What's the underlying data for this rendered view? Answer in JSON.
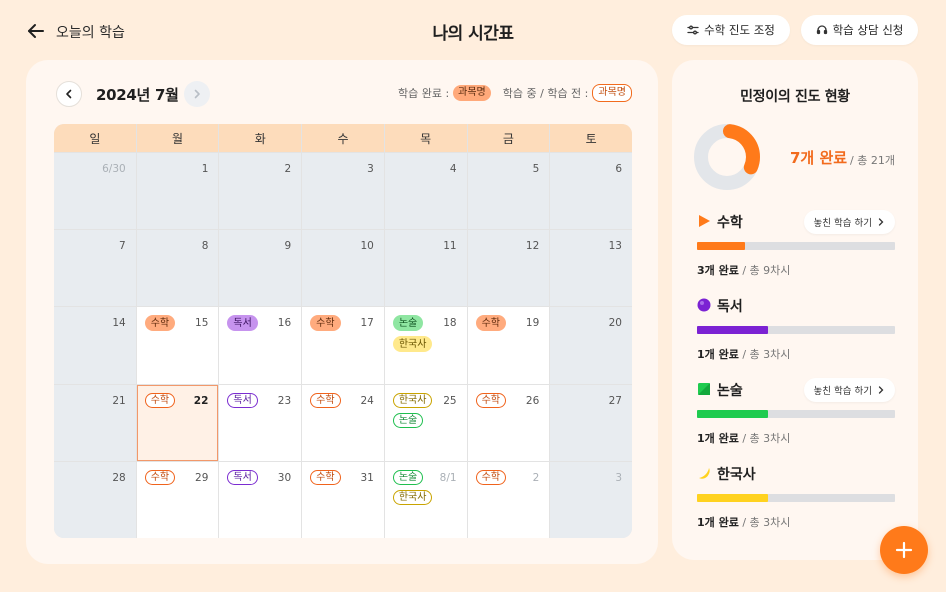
{
  "header": {
    "back_label": "오늘의 학습",
    "title": "나의 시간표",
    "adjust_button": "수학 진도 조정",
    "consult_button": "학습 상담 신청"
  },
  "calendar": {
    "month_label": "2024년 7월",
    "legend": {
      "done_label": "학습 완료 :",
      "pending_label": "학습 중 / 학습 전 :",
      "chip_text": "과목명"
    },
    "weekdays": [
      "일",
      "월",
      "화",
      "수",
      "목",
      "금",
      "토"
    ],
    "weeks": [
      [
        {
          "label": "6/30",
          "muted": true,
          "grey": true,
          "chips": []
        },
        {
          "label": "1",
          "grey": true,
          "chips": []
        },
        {
          "label": "2",
          "grey": true,
          "chips": []
        },
        {
          "label": "3",
          "grey": true,
          "chips": []
        },
        {
          "label": "4",
          "grey": true,
          "chips": []
        },
        {
          "label": "5",
          "grey": true,
          "chips": []
        },
        {
          "label": "6",
          "grey": true,
          "chips": []
        }
      ],
      [
        {
          "label": "7",
          "grey": true,
          "chips": []
        },
        {
          "label": "8",
          "grey": true,
          "chips": []
        },
        {
          "label": "9",
          "grey": true,
          "chips": []
        },
        {
          "label": "10",
          "grey": true,
          "chips": []
        },
        {
          "label": "11",
          "grey": true,
          "chips": []
        },
        {
          "label": "12",
          "grey": true,
          "chips": []
        },
        {
          "label": "13",
          "grey": true,
          "chips": []
        }
      ],
      [
        {
          "label": "14",
          "grey": true,
          "chips": []
        },
        {
          "label": "15",
          "chips": [
            {
              "text": "수학",
              "subject": "math",
              "style": "filled"
            }
          ]
        },
        {
          "label": "16",
          "chips": [
            {
              "text": "독서",
              "subject": "read",
              "style": "filled"
            }
          ]
        },
        {
          "label": "17",
          "chips": [
            {
              "text": "수학",
              "subject": "math",
              "style": "filled"
            }
          ]
        },
        {
          "label": "18",
          "chips": [
            {
              "text": "논술",
              "subject": "essay",
              "style": "filled"
            },
            {
              "text": "한국사",
              "subject": "hist",
              "style": "filled"
            }
          ]
        },
        {
          "label": "19",
          "chips": [
            {
              "text": "수학",
              "subject": "math",
              "style": "filled"
            }
          ]
        },
        {
          "label": "20",
          "grey": true,
          "chips": []
        }
      ],
      [
        {
          "label": "21",
          "grey": true,
          "chips": []
        },
        {
          "label": "22",
          "bold": true,
          "selected": true,
          "chips": [
            {
              "text": "수학",
              "subject": "math",
              "style": "outline"
            }
          ]
        },
        {
          "label": "23",
          "chips": [
            {
              "text": "독서",
              "subject": "read",
              "style": "outline"
            }
          ]
        },
        {
          "label": "24",
          "chips": [
            {
              "text": "수학",
              "subject": "math",
              "style": "outline"
            }
          ]
        },
        {
          "label": "25",
          "chips": [
            {
              "text": "한국사",
              "subject": "hist",
              "style": "outline"
            },
            {
              "text": "논술",
              "subject": "essay",
              "style": "outline"
            }
          ]
        },
        {
          "label": "26",
          "chips": [
            {
              "text": "수학",
              "subject": "math",
              "style": "outline"
            }
          ]
        },
        {
          "label": "27",
          "grey": true,
          "chips": []
        }
      ],
      [
        {
          "label": "28",
          "grey": true,
          "chips": []
        },
        {
          "label": "29",
          "chips": [
            {
              "text": "수학",
              "subject": "math",
              "style": "outline"
            }
          ]
        },
        {
          "label": "30",
          "chips": [
            {
              "text": "독서",
              "subject": "read",
              "style": "outline"
            }
          ]
        },
        {
          "label": "31",
          "chips": [
            {
              "text": "수학",
              "subject": "math",
              "style": "outline"
            }
          ]
        },
        {
          "label": "8/1",
          "muted": true,
          "chips": [
            {
              "text": "논술",
              "subject": "essay",
              "style": "outline"
            },
            {
              "text": "한국사",
              "subject": "hist",
              "style": "outline"
            }
          ]
        },
        {
          "label": "2",
          "muted": true,
          "chips": [
            {
              "text": "수학",
              "subject": "math",
              "style": "outline"
            }
          ]
        },
        {
          "label": "3",
          "muted": true,
          "grey": true,
          "chips": []
        }
      ]
    ]
  },
  "progress": {
    "title": "민정이의 진도 현황",
    "done_count": "7개 완료",
    "total": "/ 총 21개",
    "overall_fraction": 0.333,
    "subjects": [
      {
        "name": "수학",
        "icon": "play-triangle-icon",
        "color": "#FF7A1A",
        "fraction": 0.24,
        "done": "3개 완료",
        "total": "/ 총 9차시",
        "missed_button": "놓친 학습 하기"
      },
      {
        "name": "독서",
        "icon": "purple-circle-icon",
        "color": "#7B22D3",
        "fraction": 0.36,
        "done": "1개 완료",
        "total": "/ 총 3차시",
        "missed_button": null
      },
      {
        "name": "논술",
        "icon": "green-square-icon",
        "color": "#1FCB4F",
        "fraction": 0.36,
        "done": "1개 완료",
        "total": "/ 총 3차시",
        "missed_button": "놓친 학습 하기"
      },
      {
        "name": "한국사",
        "icon": "yellow-moon-icon",
        "color": "#FFD21F",
        "fraction": 0.36,
        "done": "1개 완료",
        "total": "/ 총 3차시",
        "missed_button": null
      }
    ]
  },
  "colors": {
    "accent": "#FF7A1A",
    "background": "#FFEEDD"
  }
}
